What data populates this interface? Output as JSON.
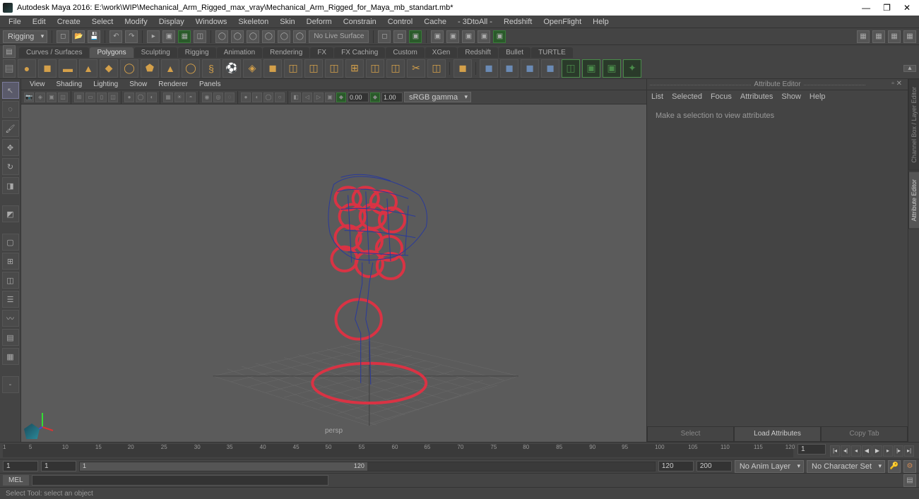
{
  "titlebar": {
    "title": "Autodesk Maya 2016: E:\\work\\WIP\\Mechanical_Arm_Rigged_max_vray\\Mechanical_Arm_Rigged_for_Maya_mb_standart.mb*"
  },
  "menubar": {
    "items": [
      "File",
      "Edit",
      "Create",
      "Select",
      "Modify",
      "Display",
      "Windows",
      "Skeleton",
      "Skin",
      "Deform",
      "Constrain",
      "Control",
      "Cache",
      "- 3DtoAll -",
      "Redshift",
      "OpenFlight",
      "Help"
    ]
  },
  "shelf": {
    "dropdown": "Rigging",
    "live_label": "No Live Surface",
    "tabs": [
      "Curves / Surfaces",
      "Polygons",
      "Sculpting",
      "Rigging",
      "Animation",
      "Rendering",
      "FX",
      "FX Caching",
      "Custom",
      "XGen",
      "Redshift",
      "Bullet",
      "TURTLE"
    ],
    "active_tab": "Polygons"
  },
  "viewport": {
    "menu": [
      "View",
      "Shading",
      "Lighting",
      "Show",
      "Renderer",
      "Panels"
    ],
    "val1": "0.00",
    "val2": "1.00",
    "colorspace": "sRGB gamma",
    "camera_label": "persp"
  },
  "attr_editor": {
    "title": "Attribute Editor",
    "menu": [
      "List",
      "Selected",
      "Focus",
      "Attributes",
      "Show",
      "Help"
    ],
    "message": "Make a selection to view attributes",
    "footer": [
      "Select",
      "Load Attributes",
      "Copy Tab"
    ]
  },
  "right_tabs": [
    "Channel Box / Layer Editor",
    "Attribute Editor"
  ],
  "timeline": {
    "ticks": [
      1,
      5,
      10,
      15,
      20,
      25,
      30,
      35,
      40,
      45,
      50,
      55,
      60,
      65,
      70,
      75,
      80,
      85,
      90,
      95,
      100,
      105,
      110,
      115,
      120
    ],
    "frame": "1"
  },
  "range": {
    "start_outer": "1",
    "start_inner": "1",
    "slider_start": "1",
    "slider_end": "120",
    "end_inner": "120",
    "end_outer": "200",
    "anim_layer": "No Anim Layer",
    "char_set": "No Character Set"
  },
  "cmd": {
    "label": "MEL"
  },
  "status": {
    "text": "Select Tool: select an object"
  }
}
